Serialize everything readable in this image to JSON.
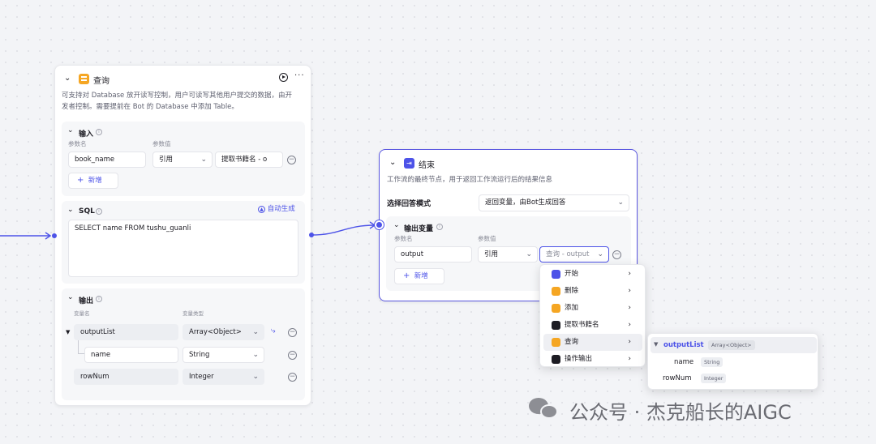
{
  "query_node": {
    "title": "查询",
    "desc_line1": "可支持对 Database 放开读写控制，用户可读写其他用户提交的数据，由开",
    "desc_line2": "发者控制。需要提前在 Bot 的 Database 中添加 Table。",
    "input": {
      "title": "输入",
      "col_name": "参数名",
      "col_value": "参数值",
      "param_name": "book_name",
      "ref_type": "引用",
      "ref_value": "提取书籍名 - o",
      "add_label": "新增"
    },
    "sql": {
      "title": "SQL",
      "auto_generate": "自动生成",
      "statement": "SELECT name FROM tushu_guanli"
    },
    "output": {
      "title": "输出",
      "col_name": "变量名",
      "col_type": "变量类型",
      "rows": [
        {
          "name": "outputList",
          "type": "Array<Object>"
        },
        {
          "name": "name",
          "type": "String"
        },
        {
          "name": "rowNum",
          "type": "Integer"
        }
      ]
    }
  },
  "end_node": {
    "title": "结束",
    "desc": "工作流的最终节点，用于返回工作流运行后的结果信息",
    "answer_mode_label": "选择回答模式",
    "answer_mode_value": "返回变量，由Bot生成回答",
    "output": {
      "title": "输出变量",
      "col_name": "参数名",
      "col_value": "参数值",
      "param_name": "output",
      "ref_type": "引用",
      "ref_placeholder": "查询 - output",
      "add_label": "新增"
    }
  },
  "ref_menu": {
    "items": [
      {
        "label": "开始",
        "color": "#4d53e8"
      },
      {
        "label": "删除",
        "color": "#f5a623"
      },
      {
        "label": "添加",
        "color": "#f5a623"
      },
      {
        "label": "提取书籍名",
        "color": "#1d1c23"
      },
      {
        "label": "查询",
        "color": "#f5a623"
      },
      {
        "label": "操作输出",
        "color": "#1d1c23"
      }
    ]
  },
  "sub_menu": {
    "parent": {
      "name": "outputList",
      "type": "Array<Object>"
    },
    "children": [
      {
        "name": "name",
        "type": "String"
      },
      {
        "name": "rowNum",
        "type": "Integer"
      }
    ]
  },
  "watermark": "公众号 · 杰克船长的AIGC",
  "colors": {
    "accent": "#4d53e8",
    "db_orange": "#f5a623"
  }
}
